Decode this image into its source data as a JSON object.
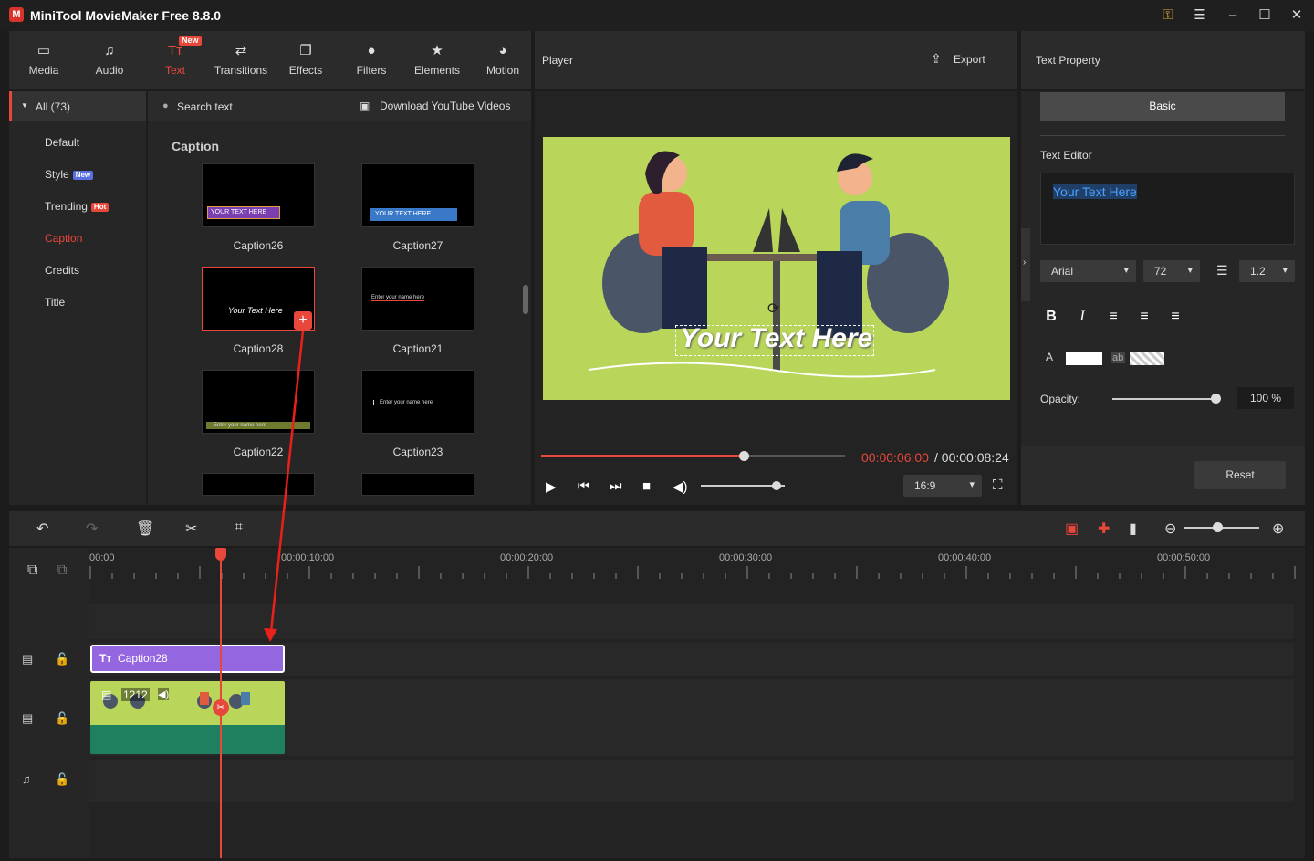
{
  "app": {
    "title": "MiniTool MovieMaker Free 8.8.0",
    "logo_letter": "M"
  },
  "window": {
    "key_icon": "key-icon",
    "menu_icon": "menu-icon",
    "min": "–",
    "max": "☐",
    "close": "✕"
  },
  "toolbar": {
    "new_badge": "New",
    "items": [
      {
        "label": "Media",
        "icon": "folder-icon"
      },
      {
        "label": "Audio",
        "icon": "music-icon"
      },
      {
        "label": "Text",
        "icon": "text-icon"
      },
      {
        "label": "Transitions",
        "icon": "transitions-icon"
      },
      {
        "label": "Effects",
        "icon": "effects-icon"
      },
      {
        "label": "Filters",
        "icon": "filters-icon"
      },
      {
        "label": "Elements",
        "icon": "elements-icon"
      },
      {
        "label": "Motion",
        "icon": "motion-icon"
      }
    ]
  },
  "categories": {
    "all": "All (73)",
    "items": [
      "Default",
      "Style",
      "Trending",
      "Caption",
      "Credits",
      "Title"
    ],
    "style_badge": "New",
    "trending_badge": "Hot"
  },
  "content": {
    "search_text": "Search text",
    "download_yt": "Download YouTube Videos",
    "section": "Caption",
    "thumbs": [
      {
        "label": "Caption26",
        "preview": "YOUR TEXT HERE"
      },
      {
        "label": "Caption27",
        "preview": "YOUR TEXT HERE"
      },
      {
        "label": "Caption28",
        "preview": "Your Text Here"
      },
      {
        "label": "Caption21",
        "preview": "Enter your name here"
      },
      {
        "label": "Caption22",
        "preview": "Enter your name here"
      },
      {
        "label": "Caption23",
        "preview": "Enter your name here"
      }
    ]
  },
  "player": {
    "title": "Player",
    "export": "Export",
    "overlay_text": "Your Text Here",
    "time_current": "00:00:06:00",
    "time_total": "/ 00:00:08:24",
    "progress": 0.67,
    "volume": 0.9,
    "ratio": "16:9"
  },
  "property": {
    "title": "Text Property",
    "tab": "Basic",
    "editor_label": "Text Editor",
    "editor_value": "Your Text Here",
    "font": "Arial",
    "size": "72",
    "line_spacing": "1.2",
    "format_buttons": [
      "B",
      "I"
    ],
    "ab_label": "ab",
    "text_color_label": "A",
    "opacity_label": "Opacity:",
    "opacity_value": "100 %",
    "opacity": 1.0,
    "reset": "Reset"
  },
  "timeline": {
    "ticks": [
      "00:00",
      "00:00:10:00",
      "00:00:20:00",
      "00:00:30:00",
      "00:00:40:00",
      "00:00:50:00"
    ],
    "caption_clip": "Caption28",
    "video_clip": "1212"
  },
  "colors": {
    "accent": "#e8473b",
    "caption_clip": "#9467e0",
    "video_bg": "#b9d65a"
  }
}
